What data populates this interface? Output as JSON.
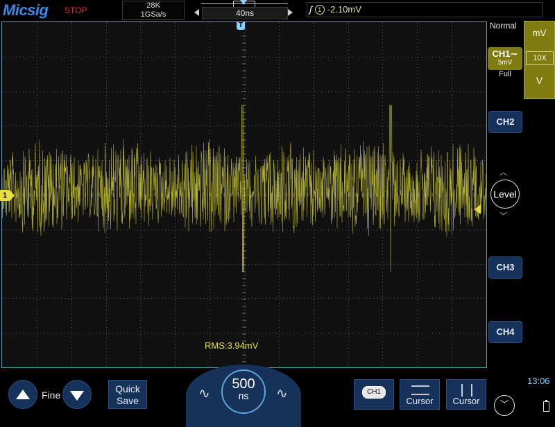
{
  "brand": {
    "logo": "Micsig",
    "run_state": "STOP"
  },
  "acquisition": {
    "memory_depth": "28K",
    "sample_rate": "1GSa/s"
  },
  "timebase": {
    "scale": "40ns",
    "knob_value": "500",
    "knob_unit": "ns"
  },
  "trigger": {
    "source": "①",
    "level": "-2.10mV",
    "mode": "Normal",
    "level_knob_label": "Level",
    "edge_icon": "rising-edge-icon",
    "pos_marker": "T"
  },
  "channel1": {
    "label": "CH1",
    "coupling_icon": "ac-coupling-icon",
    "scale": "5mV",
    "bandwidth": "Full",
    "marker": "1",
    "color": "#e6e13a"
  },
  "vertical": {
    "unit": "mV",
    "probe": "10X",
    "volts": "V"
  },
  "channels": {
    "ch2": "CH2",
    "ch3": "CH3",
    "ch4": "CH4"
  },
  "measurement": {
    "text": "RMS:3.94mV"
  },
  "bottom": {
    "fine_label": "Fine",
    "quick_save_line1": "Quick",
    "quick_save_line2": "Save",
    "ch1_selector": "CH1",
    "cursor_h_label": "Cursor",
    "cursor_v_label": "Cursor"
  },
  "status": {
    "time": "13:06"
  },
  "colors": {
    "accent_blue": "#16325a",
    "grid_border": "#5aa8c8",
    "trace": "#e6e13a",
    "stop_red": "#e03030"
  }
}
